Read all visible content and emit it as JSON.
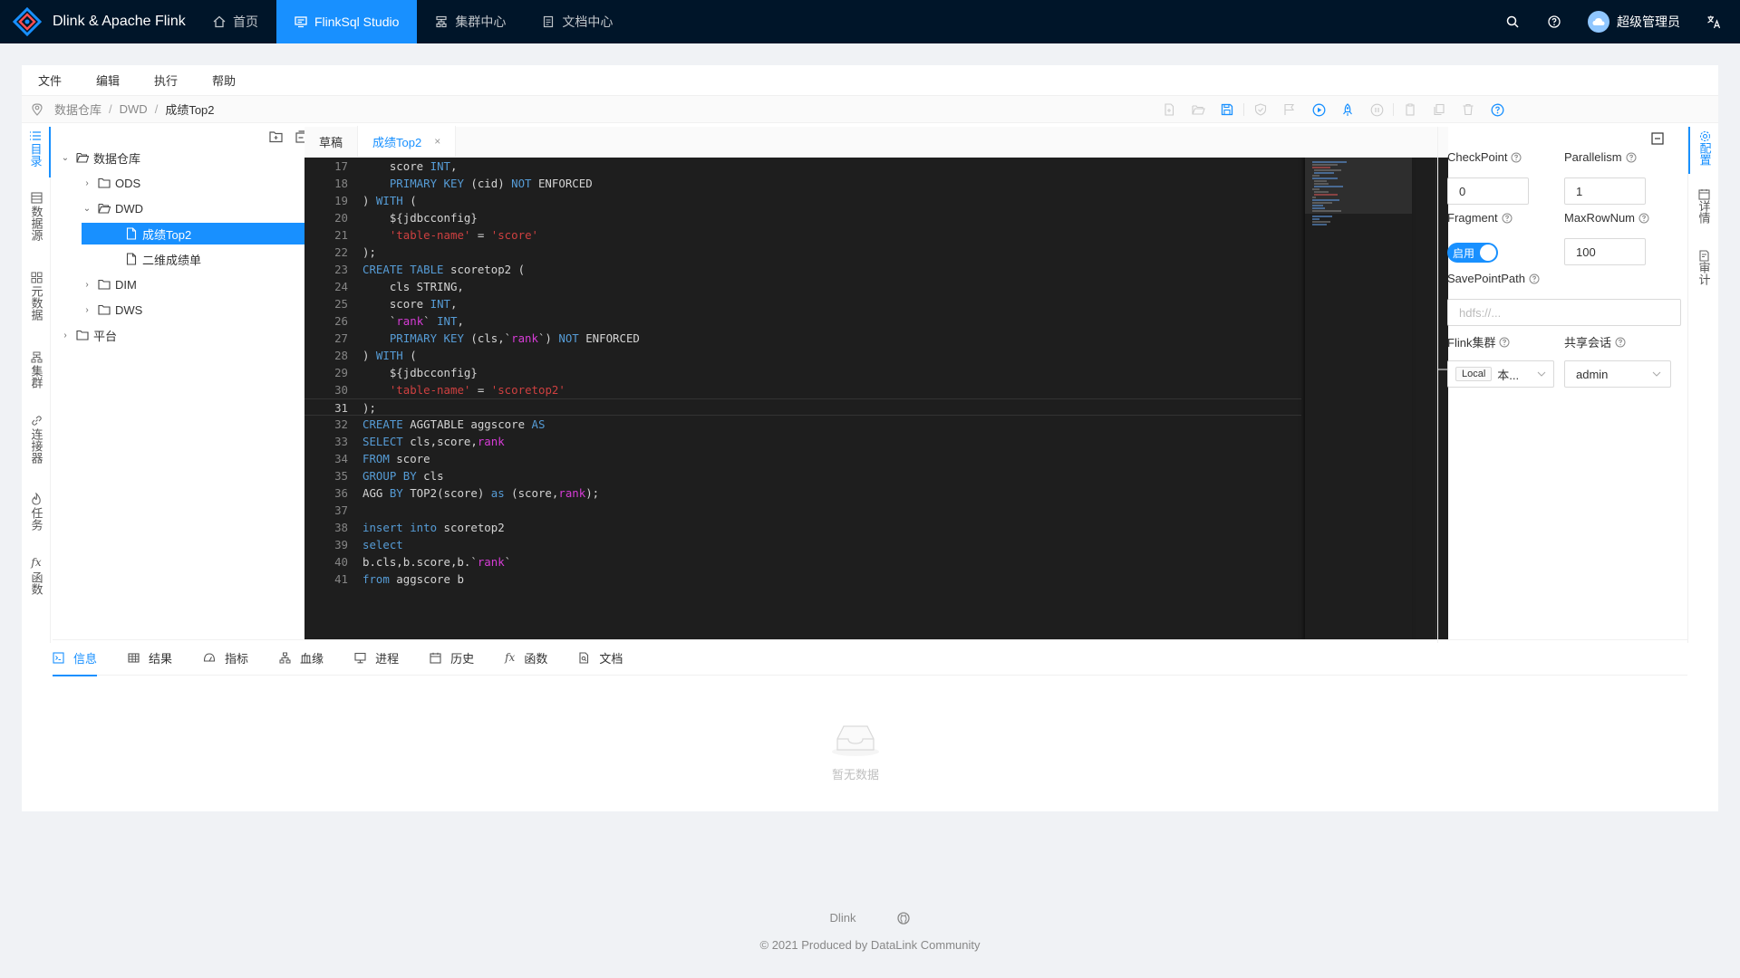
{
  "app": {
    "brand": "Dlink & Apache Flink",
    "nav": [
      {
        "label": "首页",
        "icon": "home-icon"
      },
      {
        "label": "FlinkSql Studio",
        "icon": "console-icon"
      },
      {
        "label": "集群中心",
        "icon": "cluster-icon"
      },
      {
        "label": "文档中心",
        "icon": "document-icon"
      }
    ],
    "user": "超级管理员"
  },
  "menubar": [
    "文件",
    "编辑",
    "执行",
    "帮助"
  ],
  "breadcrumb": [
    "数据仓库",
    "DWD",
    "成绩Top2"
  ],
  "left_tabs": [
    "目录",
    "数据源",
    "元数据",
    "集群",
    "连接器",
    "任务",
    "函数"
  ],
  "tree": {
    "root": "数据仓库",
    "ods": "ODS",
    "dwd": "DWD",
    "dwd_children": [
      "成绩Top2",
      "二维成绩单"
    ],
    "dim": "DIM",
    "dws": "DWS",
    "platform": "平台"
  },
  "editor": {
    "tabs": [
      {
        "label": "草稿"
      },
      {
        "label": "成绩Top2"
      }
    ],
    "close_glyph": "×",
    "current_line": 31
  },
  "config": {
    "checkpoint_label": "CheckPoint",
    "checkpoint_value": "0",
    "parallelism_label": "Parallelism",
    "parallelism_value": "1",
    "fragment_label": "Fragment",
    "fragment_switch": "启用",
    "maxrownum_label": "MaxRowNum",
    "maxrownum_value": "100",
    "savepoint_label": "SavePointPath",
    "savepoint_placeholder": "hdfs://...",
    "cluster_label": "Flink集群",
    "cluster_tag": "Local",
    "cluster_value": "本...",
    "session_label": "共享会话",
    "session_value": "admin"
  },
  "right_tabs": [
    "配置",
    "详情",
    "审计"
  ],
  "bottom_tabs": [
    "信息",
    "结果",
    "指标",
    "血缘",
    "进程",
    "历史",
    "函数",
    "文档"
  ],
  "empty_text": "暂无数据",
  "footer": {
    "link": "Dlink",
    "copyright": "2021 Produced by DataLink Community"
  },
  "colors": {
    "header_bg": "#001529",
    "accent": "#1890ff",
    "editor_bg": "#1e1e1e"
  }
}
